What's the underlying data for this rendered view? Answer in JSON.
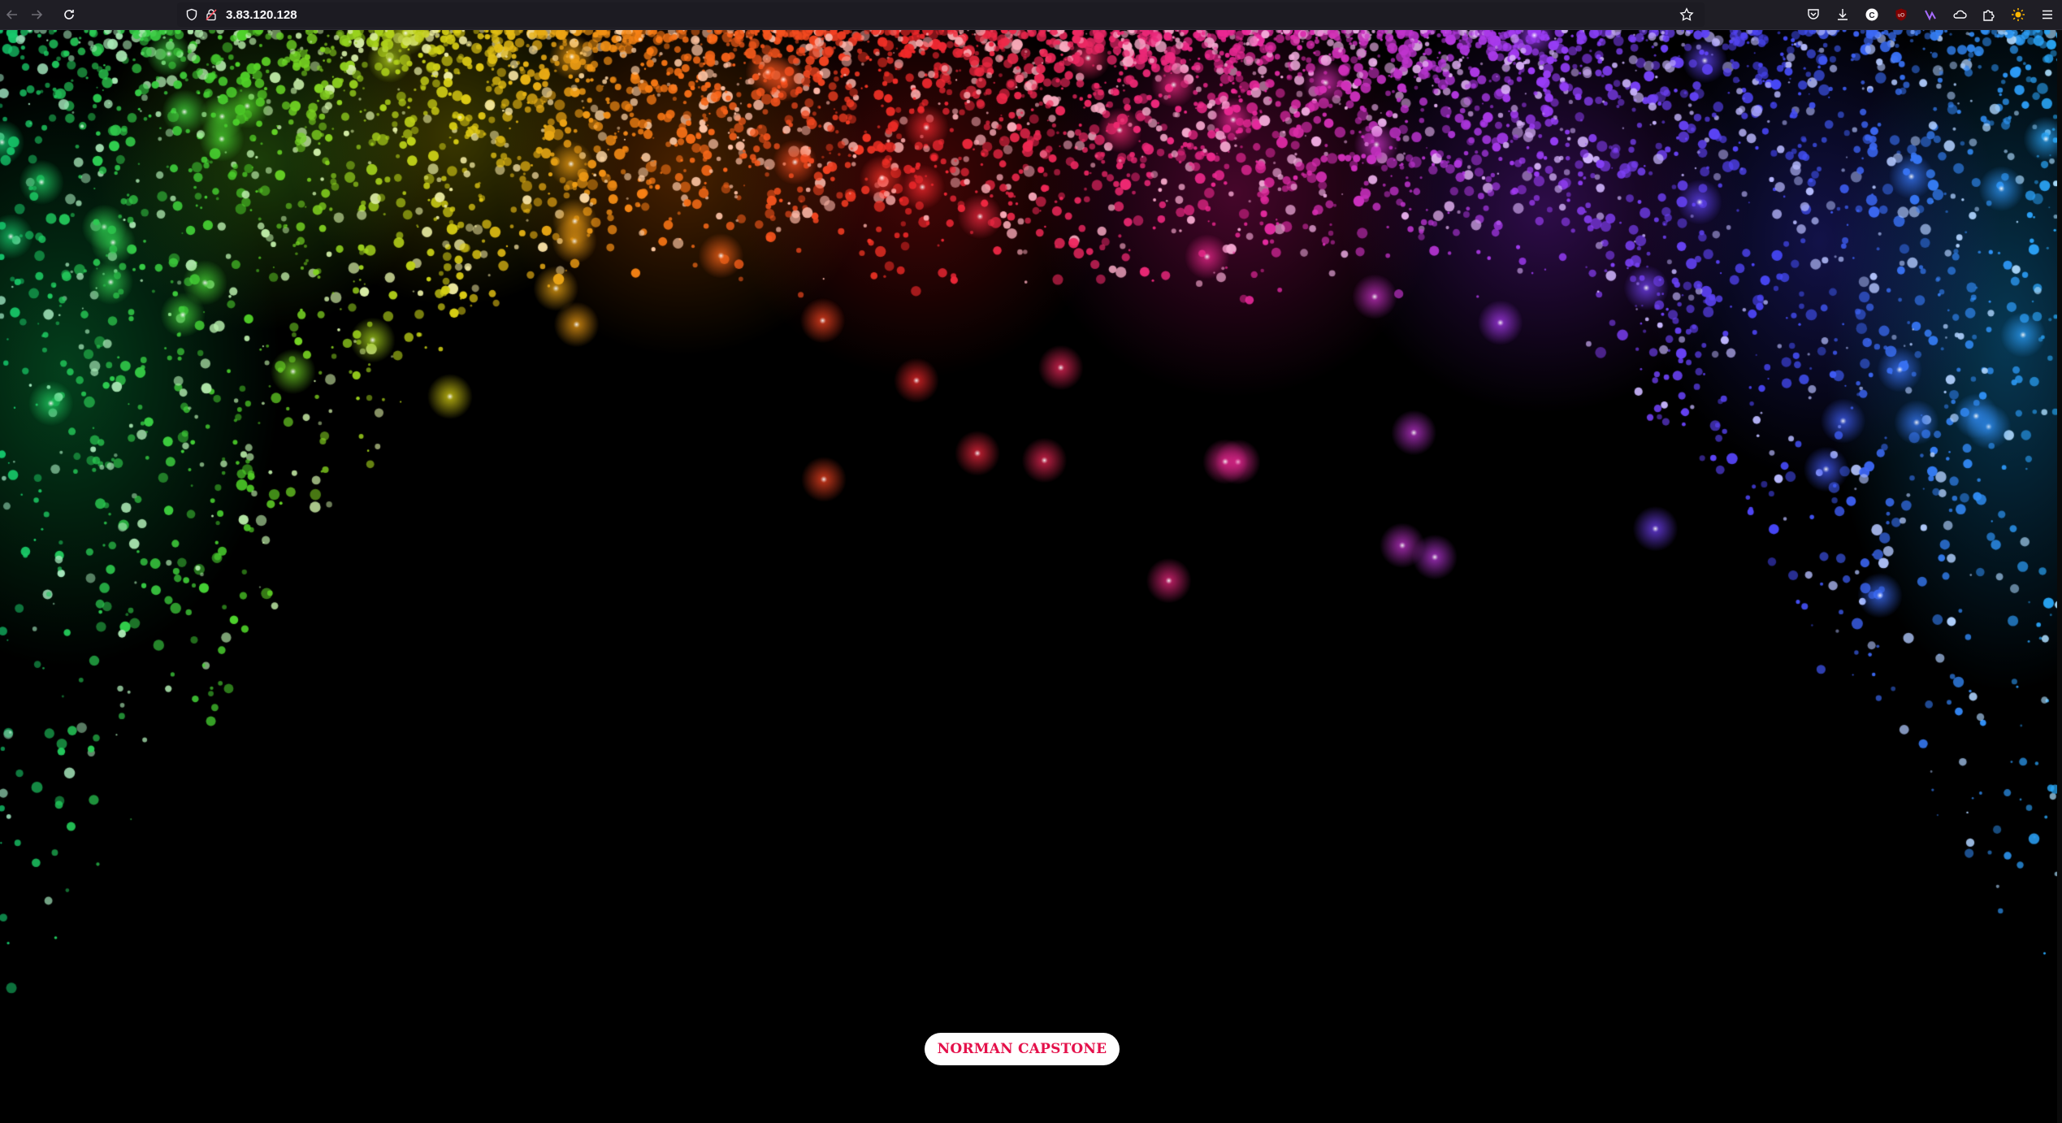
{
  "browser": {
    "url": "3.83.120.128",
    "icons": {
      "back": "back-arrow-icon",
      "forward": "forward-arrow-icon",
      "reload": "reload-icon",
      "shield": "tracking-shield-icon",
      "lock": "insecure-lock-icon",
      "bookmark": "bookmark-star-icon",
      "pocket": "pocket-icon",
      "downloads": "download-icon",
      "account": "account-c-icon",
      "ublock": "ublock-icon",
      "ext2": "extension-icon",
      "ext3": "extension-cloud-icon",
      "extensions": "puzzle-icon",
      "theme": "sun-icon",
      "menu": "hamburger-menu-icon"
    }
  },
  "page": {
    "button_label": "NORMAN CAPSTONE",
    "colors": {
      "background": "#000000",
      "button_bg": "#ffffff",
      "button_text": "#e4104a"
    }
  }
}
